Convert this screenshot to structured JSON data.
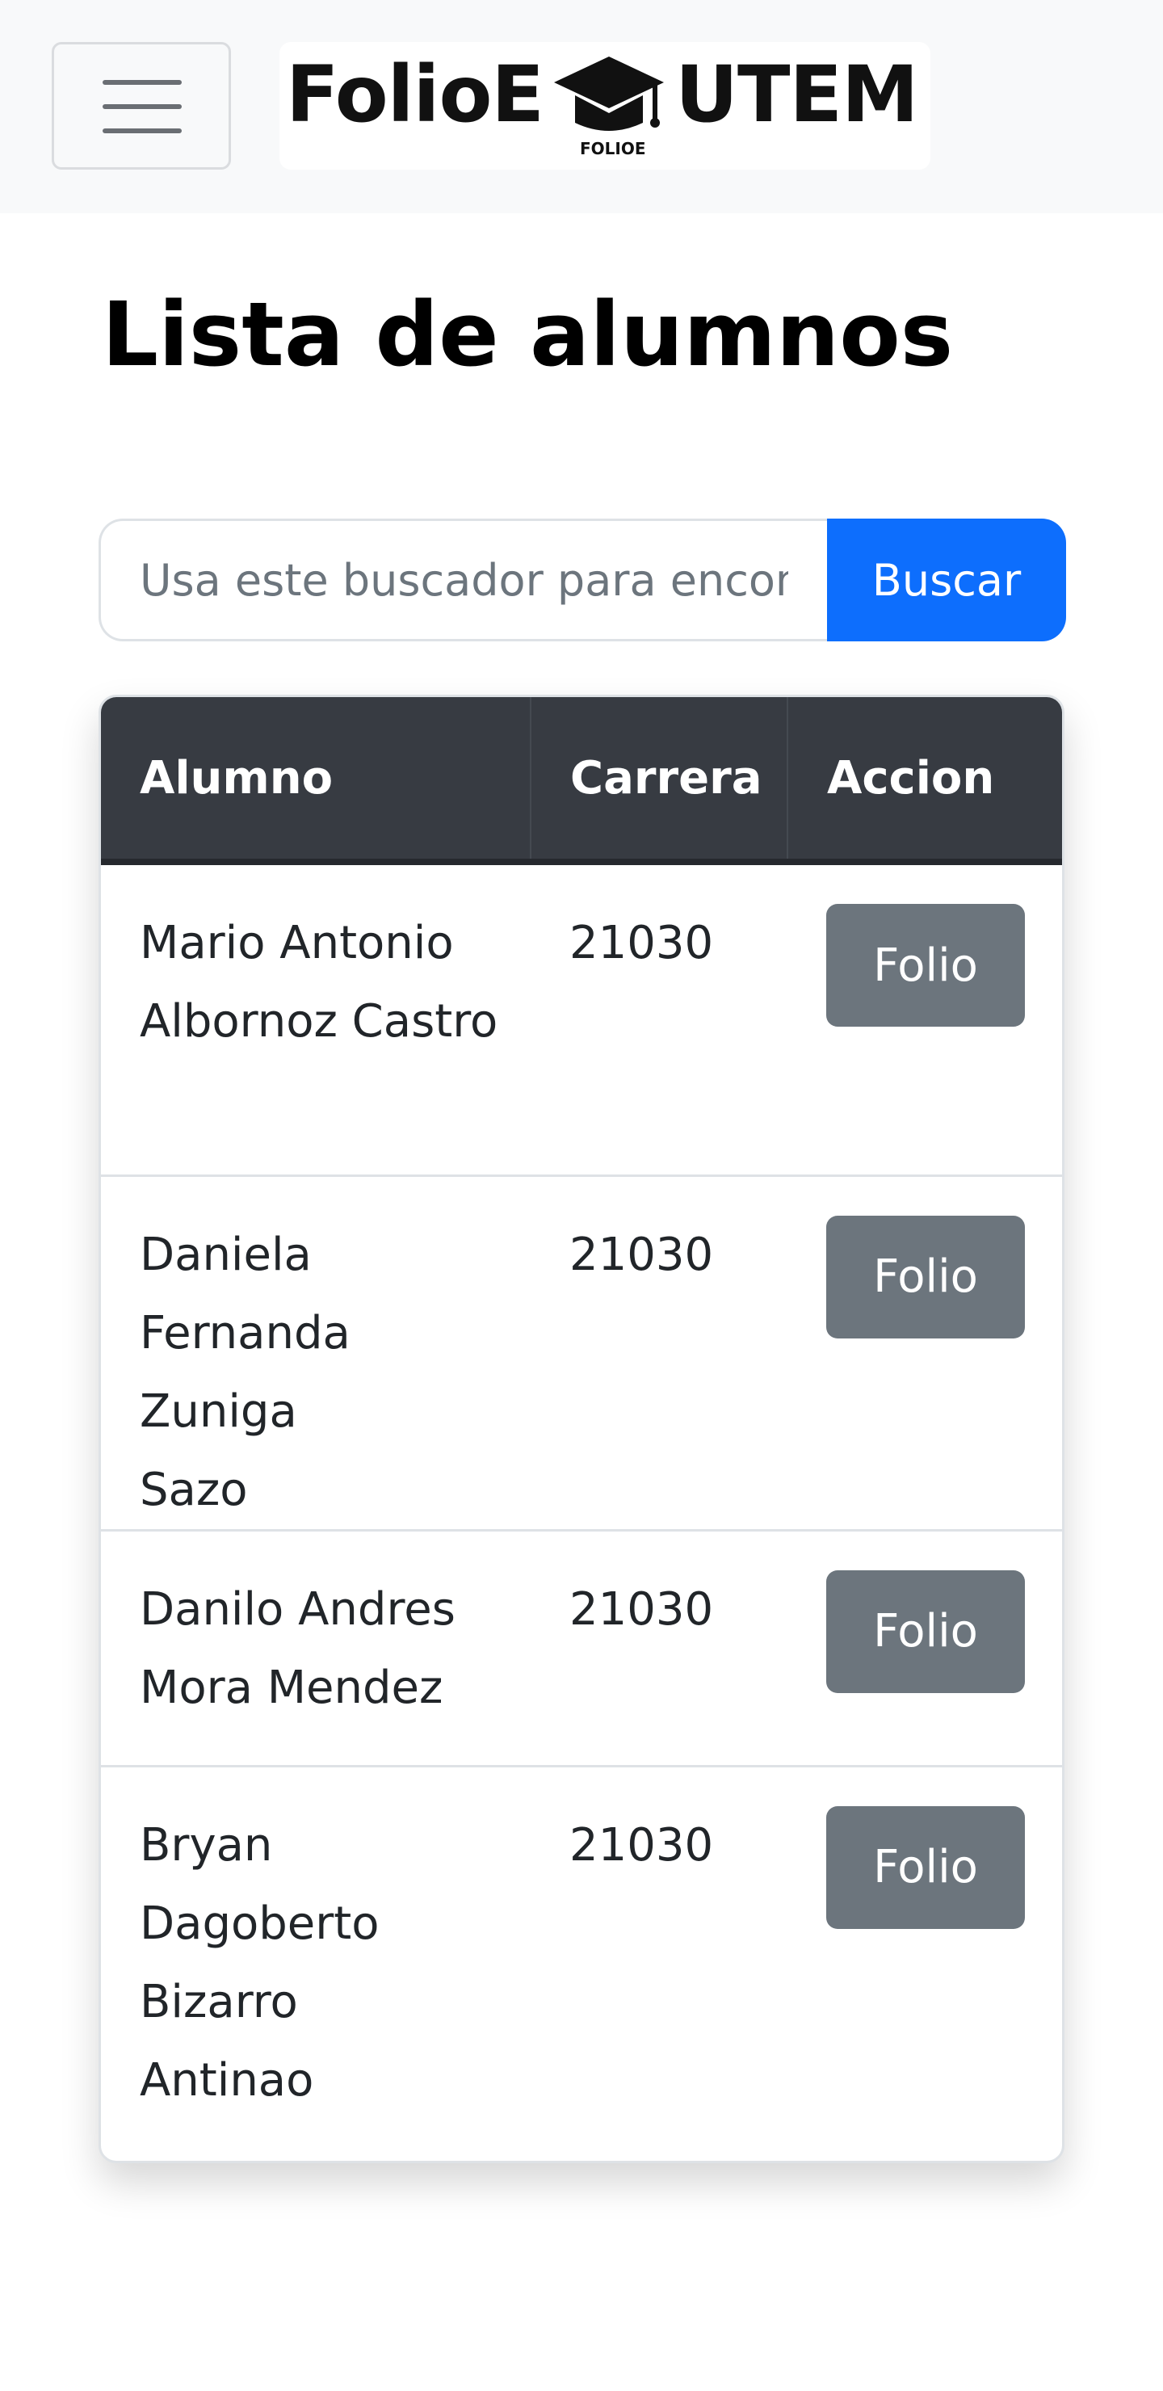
{
  "navbar": {
    "logo_text_left": "FolioE",
    "logo_text_right": "UTEM",
    "logo_subtext": "FOLIOE",
    "logo_icon": "graduation-cap-icon",
    "toggler_icon": "hamburger-menu-icon"
  },
  "page": {
    "title": "Lista de alumnos"
  },
  "search": {
    "placeholder": "Usa este buscador para encontrar alumnos",
    "button_label": "Buscar"
  },
  "table": {
    "columns": [
      "Alumno",
      "Carrera",
      "Accion"
    ],
    "rows": [
      {
        "alumno": "Mario Antonio Albornoz Castro",
        "carrera": "21030",
        "action": "Folio"
      },
      {
        "alumno": "Daniela Fernanda Zuniga Sazo",
        "carrera": "21030",
        "action": "Folio"
      },
      {
        "alumno": "Danilo Andres Mora Mendez",
        "carrera": "21030",
        "action": "Folio"
      },
      {
        "alumno": "Bryan Dagoberto Bizarro Antinao",
        "carrera": "21030",
        "action": "Folio"
      }
    ]
  },
  "colors": {
    "navbar_bg": "#f8f9fa",
    "primary": "#0d6efd",
    "secondary": "#6c757d",
    "table_header": "#373b42"
  }
}
